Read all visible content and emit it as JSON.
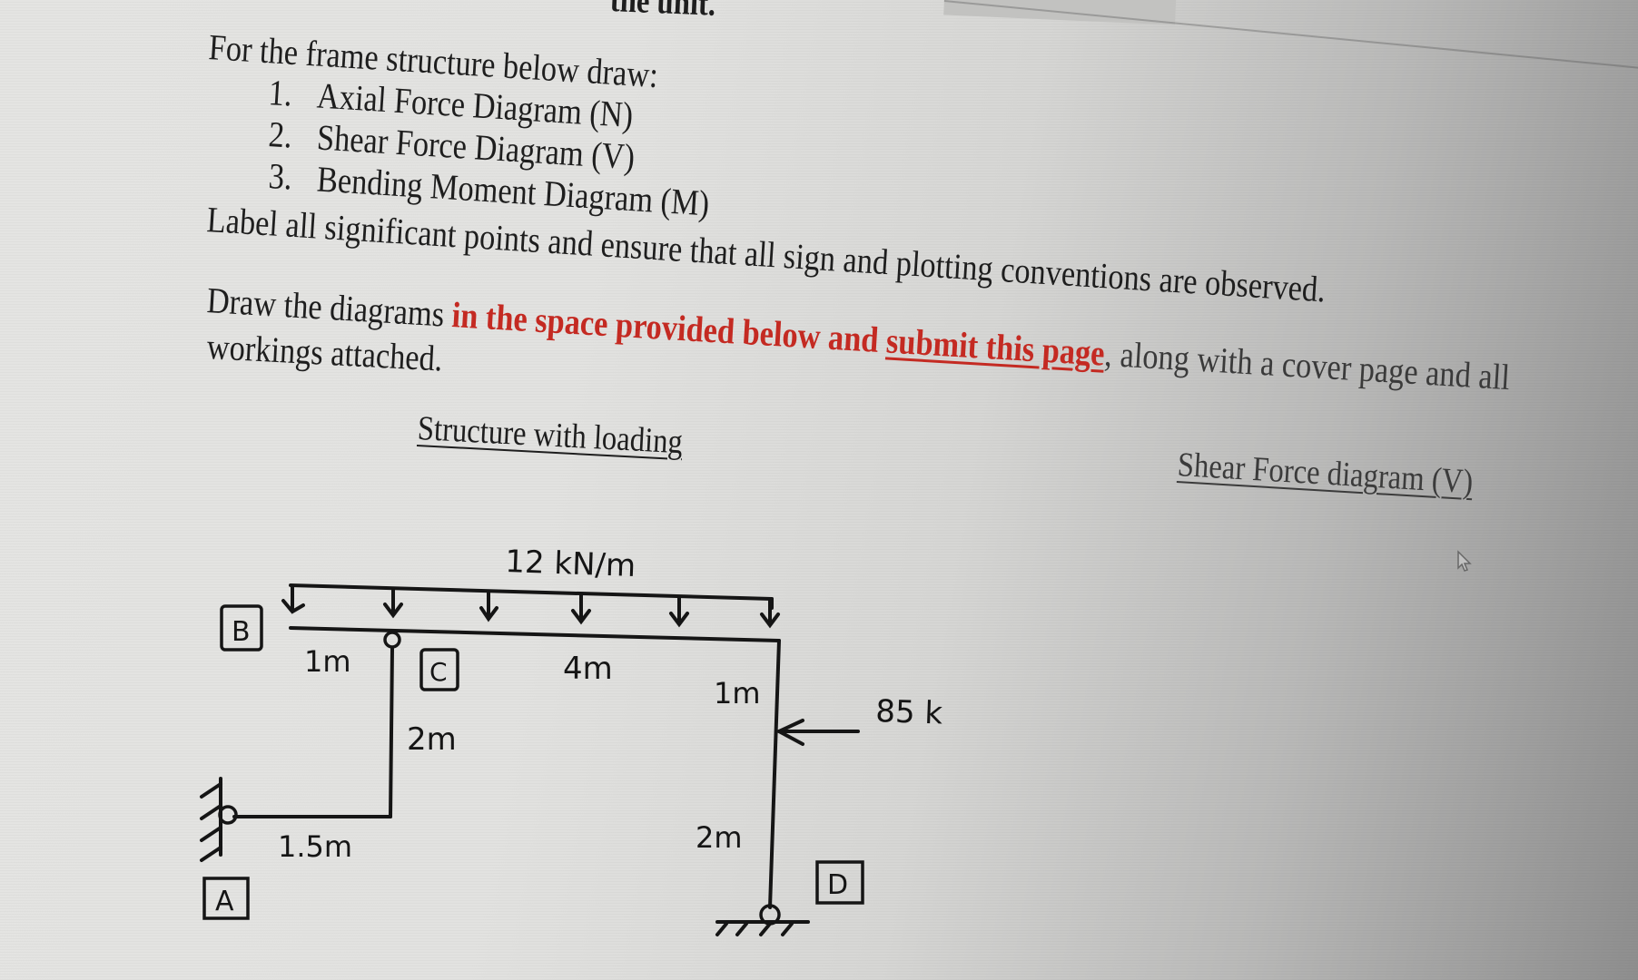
{
  "document": {
    "previous_line_tail": "the unit.",
    "intro": "For the frame structure below draw:",
    "tasks": [
      {
        "number": "1.",
        "label": "Axial Force Diagram (N)"
      },
      {
        "number": "2.",
        "label": "Shear Force Diagram (V)"
      },
      {
        "number": "3.",
        "label": "Bending Moment Diagram (M)"
      }
    ],
    "label_instruction": "Label all significant points and ensure that all sign and plotting conventions are observed.",
    "draw_instruction": {
      "part1": "Draw the diagrams ",
      "emphasis1": "in the space provided below and ",
      "emphasis2_underlined": "submit this page",
      "part2": ", along with a cover page and all",
      "part3": "workings attached."
    },
    "accent_color": "#c42a22",
    "sections": {
      "structure_title": "Structure with loading",
      "shear_title": "Shear Force diagram (V)"
    }
  },
  "structure": {
    "distributed_load": "12 kN/m",
    "point_load": "85 k",
    "nodes": [
      "A",
      "B",
      "C",
      "D"
    ],
    "dimensions": {
      "bc": "1m",
      "c_to_right": "4m",
      "c_vertical": "2m",
      "a_horizontal": "1.5m",
      "right_upper": "1m",
      "right_lower": "2m"
    },
    "supports": {
      "A": "pin-to-wall",
      "D": "pin-to-ground",
      "C": "hinge"
    }
  },
  "cursor": {
    "icon": "mouse-pointer-icon"
  }
}
